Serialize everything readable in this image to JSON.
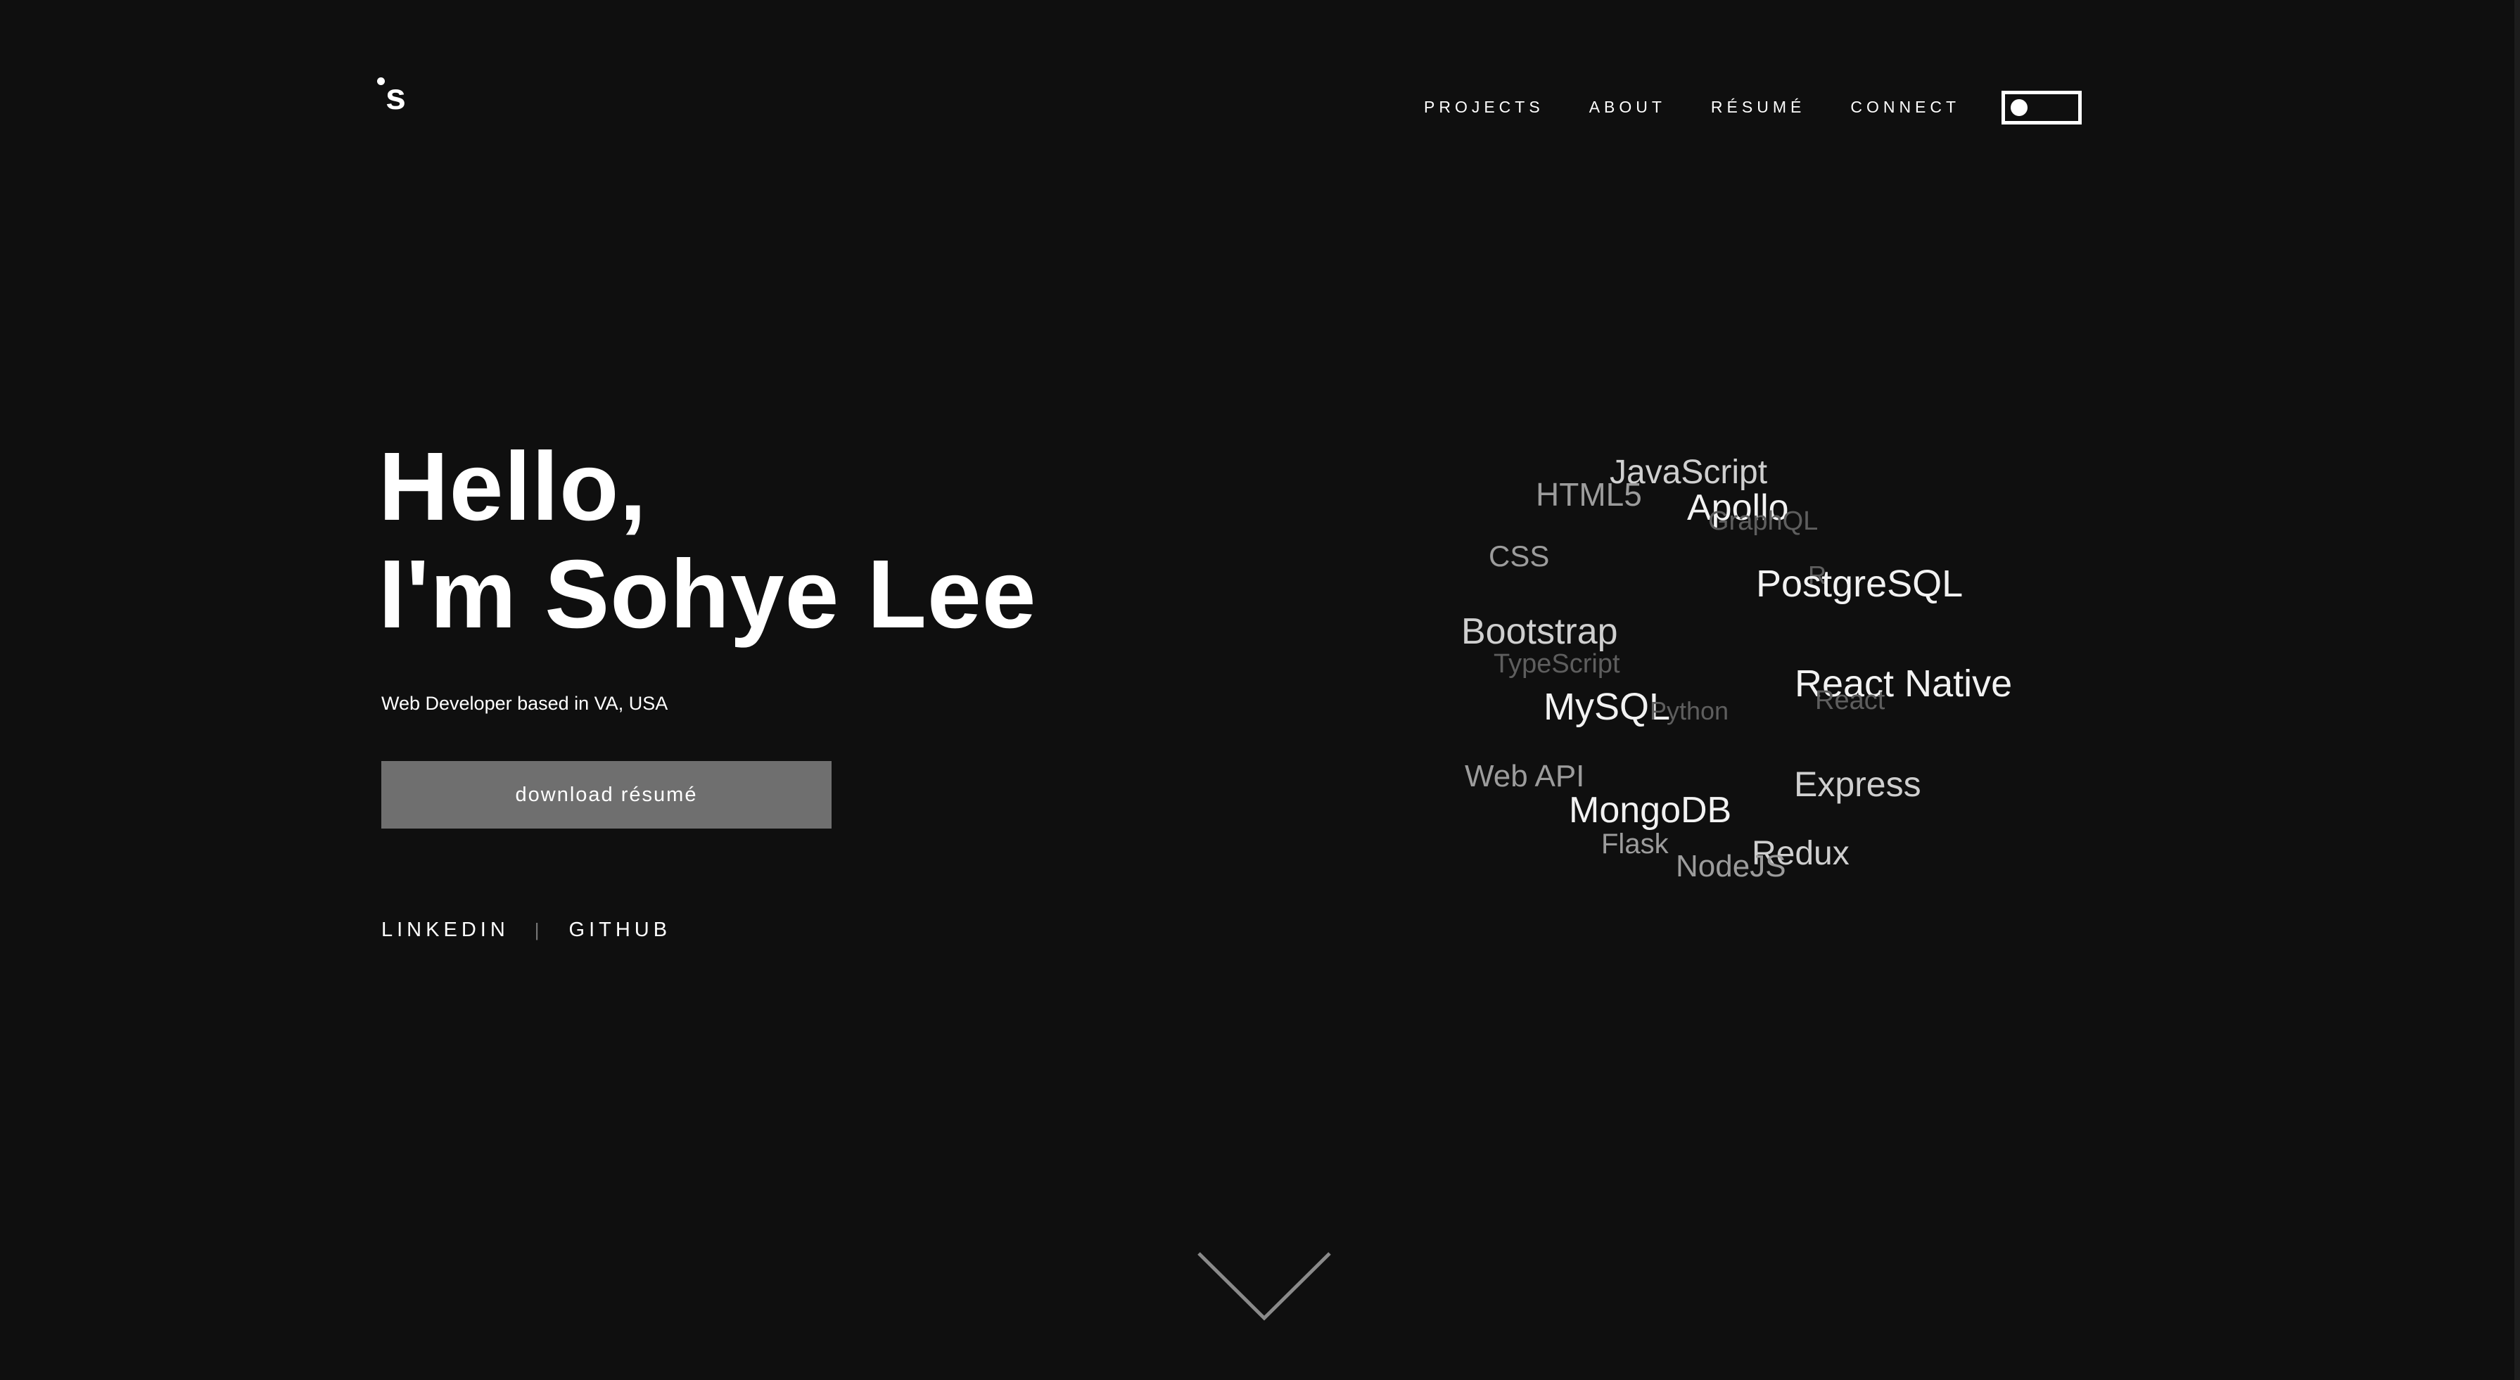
{
  "header": {
    "logo_letter": "s",
    "nav": {
      "projects": "PROJECTS",
      "about": "ABOUT",
      "resume": "RÉSUMÉ",
      "connect": "CONNECT"
    }
  },
  "hero": {
    "title_line1": "Hello,",
    "title_line2": "I'm Sohye Lee",
    "subtitle": "Web Developer based in VA, USA",
    "download_button": "download résumé",
    "social": {
      "linkedin": "LINKEDIN",
      "separator": "|",
      "github": "GITHUB"
    }
  },
  "skills": {
    "items": [
      {
        "label": "JavaScript",
        "tone": "mid"
      },
      {
        "label": "HTML5",
        "tone": "dim"
      },
      {
        "label": "Apollo",
        "tone": "bright"
      },
      {
        "label": "GraphQL",
        "tone": "faint"
      },
      {
        "label": "CSS",
        "tone": "dim"
      },
      {
        "label": "R",
        "tone": "faint"
      },
      {
        "label": "PostgreSQL",
        "tone": "bright"
      },
      {
        "label": "Bootstrap",
        "tone": "mid"
      },
      {
        "label": "TypeScript",
        "tone": "faint"
      },
      {
        "label": "React Native",
        "tone": "bright"
      },
      {
        "label": "React",
        "tone": "faint"
      },
      {
        "label": "MySQL",
        "tone": "bright"
      },
      {
        "label": "Python",
        "tone": "faint"
      },
      {
        "label": "Web API",
        "tone": "dim"
      },
      {
        "label": "Express",
        "tone": "mid"
      },
      {
        "label": "MongoDB",
        "tone": "bright"
      },
      {
        "label": "Flask",
        "tone": "dim"
      },
      {
        "label": "Redux",
        "tone": "mid"
      },
      {
        "label": "NodeJS",
        "tone": "dim"
      }
    ]
  },
  "colors": {
    "background": "#0f0f0f",
    "text": "#ffffff",
    "button": "#6f6f6f",
    "arrow": "#8a8a8a"
  },
  "icons": {
    "scroll": "chevron-down-icon"
  }
}
